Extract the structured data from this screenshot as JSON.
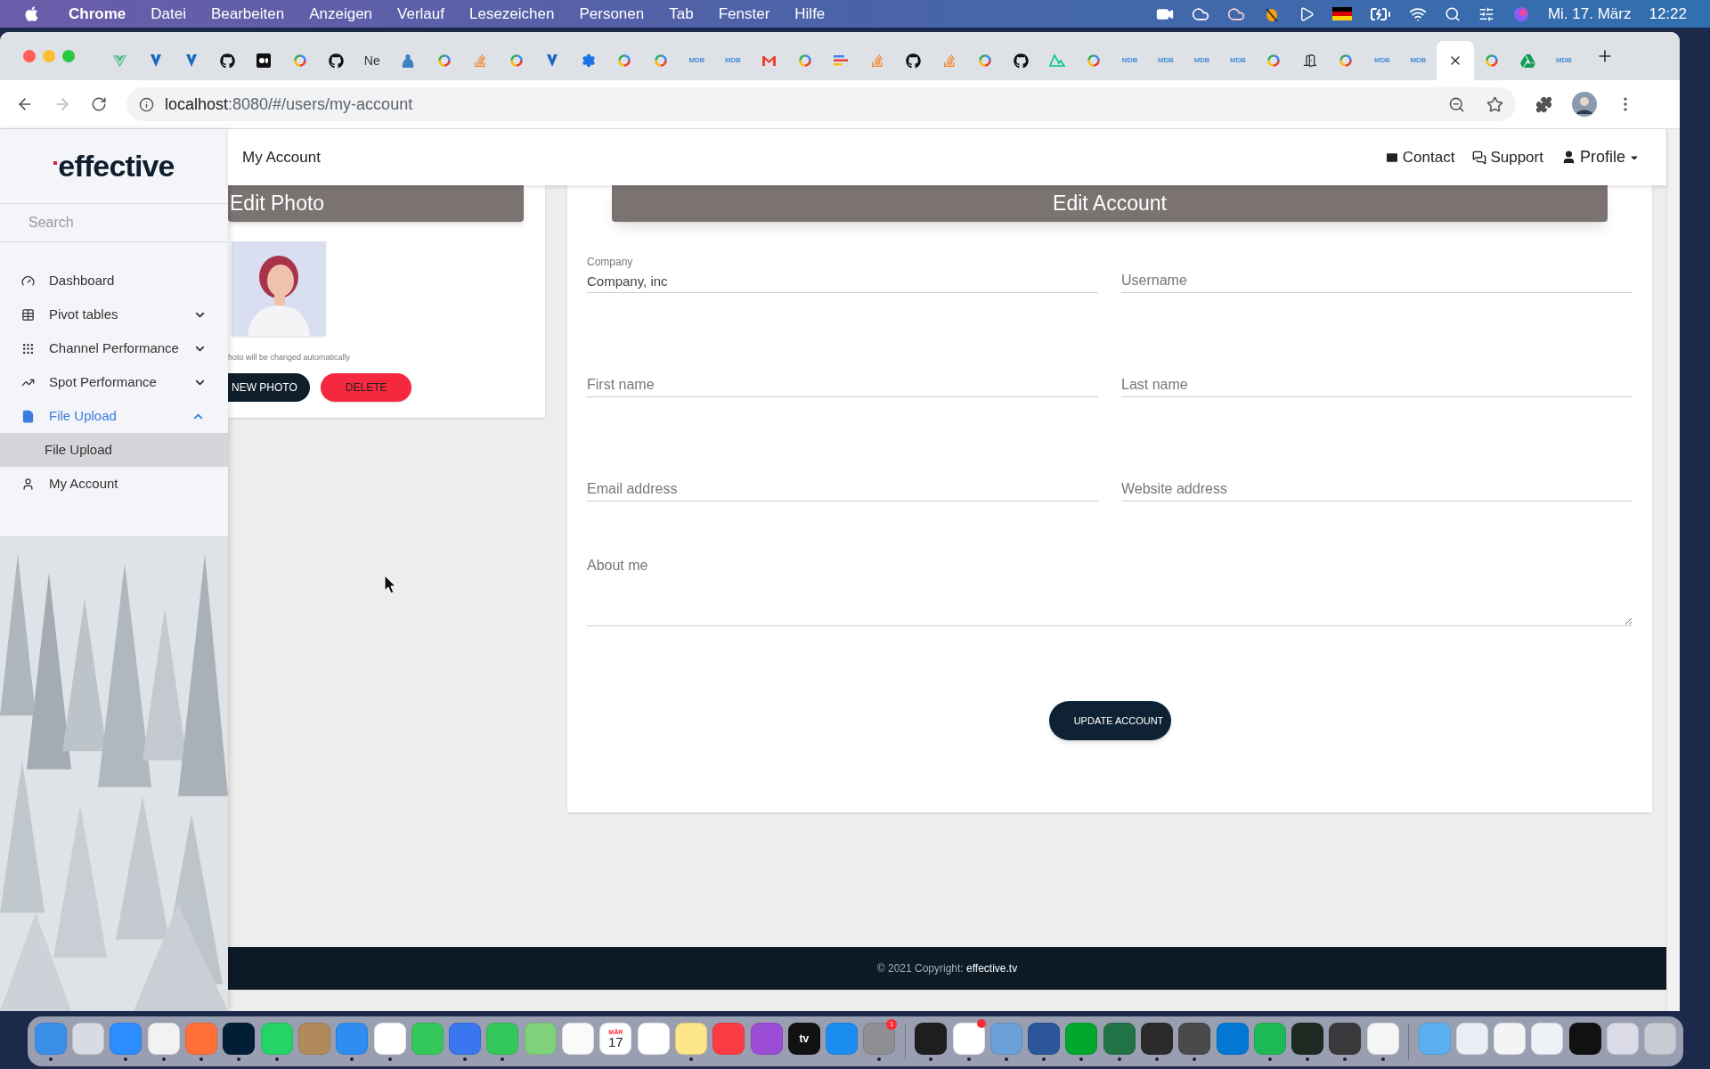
{
  "menu_bar": {
    "app": "Chrome",
    "menus": [
      "Datei",
      "Bearbeiten",
      "Anzeigen",
      "Verlauf",
      "Lesezeichen",
      "Personen",
      "Tab",
      "Fenster",
      "Hilfe"
    ],
    "date": "Mi. 17. März",
    "time": "12:22"
  },
  "tabs": [
    {
      "kind": "vue",
      "selected": false
    },
    {
      "kind": "vuetify",
      "selected": false
    },
    {
      "kind": "vuetify",
      "selected": false
    },
    {
      "kind": "github",
      "selected": false
    },
    {
      "kind": "medium",
      "selected": false
    },
    {
      "kind": "google",
      "selected": false
    },
    {
      "kind": "github",
      "selected": false
    },
    {
      "kind": "text",
      "label": "Ne",
      "selected": false
    },
    {
      "kind": "figure",
      "selected": false
    },
    {
      "kind": "google",
      "selected": false
    },
    {
      "kind": "stack",
      "selected": false
    },
    {
      "kind": "google",
      "selected": false
    },
    {
      "kind": "vuetify",
      "selected": false
    },
    {
      "kind": "gear",
      "selected": false
    },
    {
      "kind": "google",
      "selected": false
    },
    {
      "kind": "google",
      "selected": false
    },
    {
      "kind": "text_mdb",
      "label": "MDB",
      "selected": false
    },
    {
      "kind": "text_mdb",
      "label": "MDB",
      "selected": false
    },
    {
      "kind": "gmail",
      "selected": false
    },
    {
      "kind": "google",
      "selected": false
    },
    {
      "kind": "bars",
      "selected": false
    },
    {
      "kind": "stack",
      "selected": false
    },
    {
      "kind": "github",
      "selected": false
    },
    {
      "kind": "stack",
      "selected": false
    },
    {
      "kind": "google",
      "selected": false
    },
    {
      "kind": "github",
      "selected": false
    },
    {
      "kind": "nuxt",
      "selected": false
    },
    {
      "kind": "google",
      "selected": false
    },
    {
      "kind": "text_mdb",
      "label": "MDB",
      "selected": false
    },
    {
      "kind": "text_mdb",
      "label": "MDB",
      "selected": false
    },
    {
      "kind": "text_mdb",
      "label": "MDB",
      "selected": false
    },
    {
      "kind": "text_mdb",
      "label": "MDB",
      "selected": false
    },
    {
      "kind": "google",
      "selected": false
    },
    {
      "kind": "door",
      "selected": false
    },
    {
      "kind": "google",
      "selected": false
    },
    {
      "kind": "text_mdb",
      "label": "MDB",
      "selected": false
    },
    {
      "kind": "text_mdb",
      "label": "MDB",
      "selected": false
    },
    {
      "kind": "blank",
      "selected": true
    },
    {
      "kind": "google",
      "selected": false
    },
    {
      "kind": "drive",
      "selected": false
    },
    {
      "kind": "text_mdb",
      "label": "MDB",
      "selected": false
    }
  ],
  "address_bar": {
    "host": "localhost",
    "path": ":8080/#/users/my-account"
  },
  "sidebar": {
    "logo": "effective",
    "search": {
      "placeholder": "Search"
    },
    "items": [
      {
        "label": "Dashboard",
        "selected": false
      },
      {
        "label": "Pivot tables",
        "selected": false,
        "expanded": false
      },
      {
        "label": "Channel Performance",
        "selected": false,
        "expanded": false
      },
      {
        "label": "Spot Performance",
        "selected": false,
        "expanded": false
      },
      {
        "label": "File Upload",
        "selected": true,
        "expanded": true,
        "children": [
          {
            "label": "File Upload",
            "selected": true
          }
        ]
      },
      {
        "label": "My Account",
        "selected": false
      }
    ]
  },
  "top_bar": {
    "title": "My Account",
    "links": [
      "Contact",
      "Support"
    ],
    "profile": "Profile"
  },
  "photo_card": {
    "title": "Edit Photo",
    "note": "hoto will be changed automatically",
    "buttons": [
      "NEW PHOTO",
      "DELETE"
    ]
  },
  "account_card": {
    "title": "Edit Account",
    "fields": [
      {
        "label": "Company",
        "value": "Company, inc"
      },
      {
        "placeholder": "Username"
      },
      {
        "placeholder": "First name"
      },
      {
        "placeholder": "Last name"
      },
      {
        "placeholder": "Email address"
      },
      {
        "placeholder": "Website address"
      }
    ],
    "about": {
      "placeholder": "About me"
    },
    "button": "UPDATE ACCOUNT"
  },
  "footer": {
    "text": "© 2021 Copyright:",
    "link": "effective.tv"
  },
  "dock": {
    "apps": [
      {
        "color": "#3b8fe8",
        "running": true
      },
      {
        "color": "#d8dbe3",
        "running": false
      },
      {
        "color": "#2d8cff",
        "running": true
      },
      {
        "color": "#f2f2f2",
        "running": true
      },
      {
        "color": "#ff7139",
        "running": true
      },
      {
        "color": "#001e36",
        "running": true
      },
      {
        "color": "#25d366",
        "running": true
      },
      {
        "color": "#b08a5a",
        "running": false
      },
      {
        "color": "#2f8cf0",
        "running": true
      },
      {
        "color": "#ffffff",
        "running": true
      },
      {
        "color": "#34c759",
        "running": false
      },
      {
        "color": "#3a76f0",
        "running": true
      },
      {
        "color": "#34c759",
        "running": true
      },
      {
        "color": "#7fd17a",
        "running": false
      },
      {
        "color": "#fafafa",
        "running": false
      },
      {
        "color": "#ffffff",
        "running": false,
        "month": "MÄR",
        "day": "17"
      },
      {
        "color": "#ffffff",
        "running": false
      },
      {
        "color": "#fde68a",
        "running": true
      },
      {
        "color": "#fc3c44",
        "running": false
      },
      {
        "color": "#9b4dd6",
        "running": false
      },
      {
        "color": "#111111",
        "running": false,
        "label": "tv"
      },
      {
        "color": "#1c8df0",
        "running": false
      },
      {
        "color": "#8e8e93",
        "running": true,
        "badge": "1"
      }
    ],
    "tools": [
      {
        "color": "#1e1e1e",
        "running": true
      },
      {
        "color": "#ffffff",
        "running": true,
        "alert": true
      },
      {
        "color": "#6aa0d8",
        "running": true
      },
      {
        "color": "#2b579a",
        "running": true
      },
      {
        "color": "#00a82d",
        "running": true
      },
      {
        "color": "#217346",
        "running": true
      },
      {
        "color": "#2b2b2b",
        "running": true
      },
      {
        "color": "#4a4a4a",
        "running": true
      },
      {
        "color": "#0078d4",
        "running": false
      },
      {
        "color": "#1db954",
        "running": true
      },
      {
        "color": "#1c2a22",
        "running": true
      },
      {
        "color": "#3a3a3c",
        "running": true
      },
      {
        "color": "#f5f5f5",
        "running": true
      }
    ],
    "stacks": [
      {
        "color": "#5ab0f0",
        "running": false
      },
      {
        "color": "#e8eef4",
        "running": false
      },
      {
        "color": "#f4f4f4",
        "running": false
      },
      {
        "color": "#eef2f6",
        "running": false
      },
      {
        "color": "#111111",
        "running": false
      },
      {
        "color": "#dcdce8",
        "running": false
      },
      {
        "color": "#c9ccd2",
        "running": false
      }
    ]
  }
}
